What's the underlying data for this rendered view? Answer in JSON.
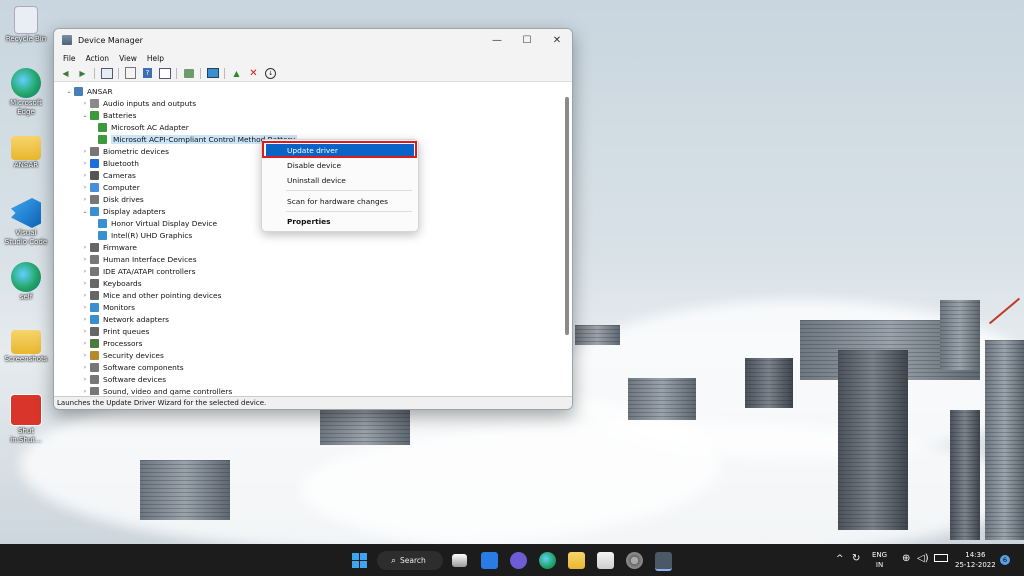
{
  "desktop": {
    "icons": [
      {
        "label": "Recycle Bin",
        "icon": "recycle-bin-icon",
        "color": "#e8eef3"
      },
      {
        "label": "Microsoft Edge",
        "icon": "edge-icon",
        "color": "#1fa35a"
      },
      {
        "label": "ANSAR",
        "icon": "folder-icon",
        "color": "#f5c542"
      },
      {
        "label": "Visual Studio Code",
        "icon": "vscode-icon",
        "color": "#1e88e5"
      },
      {
        "label": "self",
        "icon": "edge-icon",
        "color": "#1fa35a"
      },
      {
        "label": "Screenshots",
        "icon": "folder-icon",
        "color": "#f5c542"
      },
      {
        "label": "Shut in:Shut...",
        "icon": "shutdown-icon",
        "color": "#d9352b"
      }
    ]
  },
  "window": {
    "title": "Device Manager",
    "controls": {
      "minimize": "—",
      "maximize": "☐",
      "close": "✕"
    },
    "menu": [
      "File",
      "Action",
      "View",
      "Help"
    ],
    "status": "Launches the Update Driver Wizard for the selected device."
  },
  "tree": [
    {
      "label": "ANSAR",
      "level": 0,
      "expanded": true,
      "icon": "computer-icon",
      "color": "#4a7fb5"
    },
    {
      "label": "Audio inputs and outputs",
      "level": 1,
      "expanded": false,
      "icon": "speaker-icon",
      "color": "#8a8a8a"
    },
    {
      "label": "Batteries",
      "level": 1,
      "expanded": true,
      "icon": "battery-icon",
      "color": "#3c9a3c"
    },
    {
      "label": "Microsoft AC Adapter",
      "level": 2,
      "icon": "battery-icon",
      "color": "#3c9a3c"
    },
    {
      "label": "Microsoft ACPI-Compliant Control Method Battery",
      "level": 2,
      "selected": true,
      "icon": "battery-icon",
      "color": "#3c9a3c"
    },
    {
      "label": "Biometric devices",
      "level": 1,
      "expanded": false,
      "icon": "biometric-icon",
      "color": "#777777"
    },
    {
      "label": "Bluetooth",
      "level": 1,
      "expanded": false,
      "icon": "bluetooth-icon",
      "color": "#1e6fd9"
    },
    {
      "label": "Cameras",
      "level": 1,
      "expanded": false,
      "icon": "camera-icon",
      "color": "#555555"
    },
    {
      "label": "Computer",
      "level": 1,
      "expanded": false,
      "icon": "monitor-icon",
      "color": "#4a90d9"
    },
    {
      "label": "Disk drives",
      "level": 1,
      "expanded": false,
      "icon": "disk-icon",
      "color": "#777777"
    },
    {
      "label": "Display adapters",
      "level": 1,
      "expanded": true,
      "icon": "display-icon",
      "color": "#3a8fd0"
    },
    {
      "label": "Honor Virtual Display Device",
      "level": 2,
      "icon": "display-icon",
      "color": "#3a8fd0"
    },
    {
      "label": "Intel(R) UHD Graphics",
      "level": 2,
      "icon": "display-icon",
      "color": "#3a8fd0"
    },
    {
      "label": "Firmware",
      "level": 1,
      "expanded": false,
      "icon": "firmware-icon",
      "color": "#666666"
    },
    {
      "label": "Human Interface Devices",
      "level": 1,
      "expanded": false,
      "icon": "hid-icon",
      "color": "#777777"
    },
    {
      "label": "IDE ATA/ATAPI controllers",
      "level": 1,
      "expanded": false,
      "icon": "ide-icon",
      "color": "#777777"
    },
    {
      "label": "Keyboards",
      "level": 1,
      "expanded": false,
      "icon": "keyboard-icon",
      "color": "#666666"
    },
    {
      "label": "Mice and other pointing devices",
      "level": 1,
      "expanded": false,
      "icon": "mouse-icon",
      "color": "#666666"
    },
    {
      "label": "Monitors",
      "level": 1,
      "expanded": false,
      "icon": "monitor-icon",
      "color": "#3a8fd0"
    },
    {
      "label": "Network adapters",
      "level": 1,
      "expanded": false,
      "icon": "network-icon",
      "color": "#3a8fd0"
    },
    {
      "label": "Print queues",
      "level": 1,
      "expanded": false,
      "icon": "printer-icon",
      "color": "#666666"
    },
    {
      "label": "Processors",
      "level": 1,
      "expanded": false,
      "icon": "processor-icon",
      "color": "#4c7a3c"
    },
    {
      "label": "Security devices",
      "level": 1,
      "expanded": false,
      "icon": "security-icon",
      "color": "#b38b2a"
    },
    {
      "label": "Software components",
      "level": 1,
      "expanded": false,
      "icon": "software-icon",
      "color": "#777777"
    },
    {
      "label": "Software devices",
      "level": 1,
      "expanded": false,
      "icon": "software-icon",
      "color": "#777777"
    },
    {
      "label": "Sound, video and game controllers",
      "level": 1,
      "expanded": false,
      "icon": "sound-icon",
      "color": "#777777"
    }
  ],
  "context_menu": {
    "update": "Update driver",
    "disable": "Disable device",
    "uninstall": "Uninstall device",
    "scan": "Scan for hardware changes",
    "properties": "Properties"
  },
  "taskbar": {
    "search_label": "Search",
    "lang_top": "ENG",
    "lang_bottom": "IN",
    "time": "14:36",
    "date": "25-12-2022",
    "notification_count": "6",
    "accent": "#0a64c8"
  }
}
